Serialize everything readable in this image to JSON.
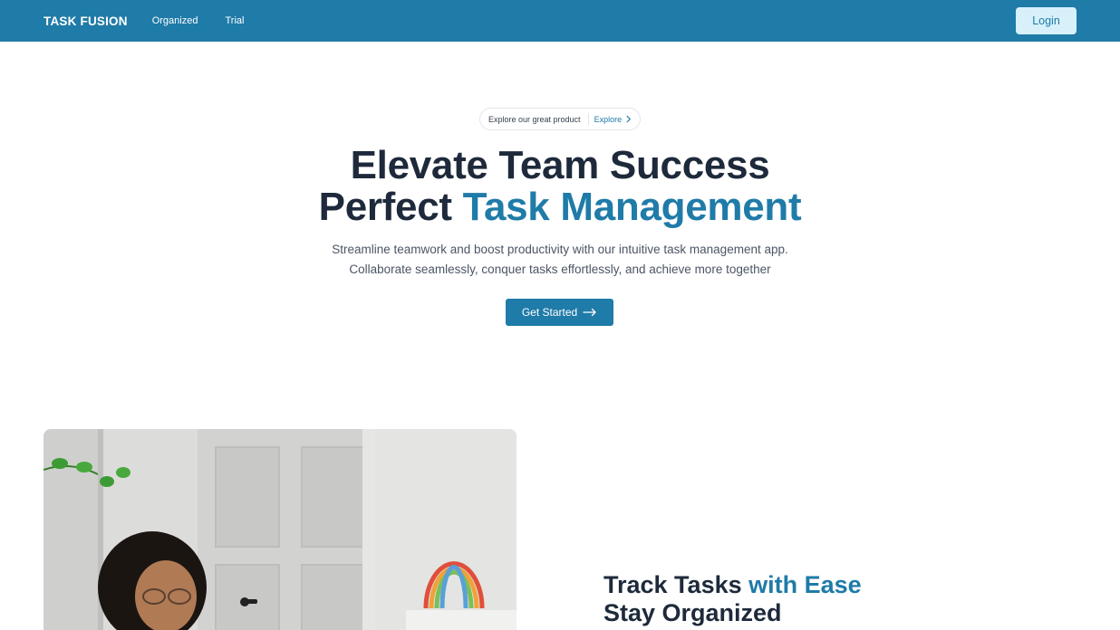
{
  "nav": {
    "brand": "TASK FUSION",
    "links": [
      "Organized",
      "Trial"
    ],
    "login_label": "Login"
  },
  "hero": {
    "pill_text": "Explore our great product",
    "pill_link": "Explore",
    "title_line1": "Elevate Team Success",
    "title_line2_plain": "Perfect ",
    "title_line2_accent": "Task Management",
    "subtitle_line1": "Streamline teamwork and boost productivity with our intuitive task management app.",
    "subtitle_line2": "Collaborate seamlessly, conquer tasks effortlessly, and achieve more together",
    "cta_label": "Get Started"
  },
  "feature": {
    "title_plain": "Track Tasks ",
    "title_accent": "with Ease",
    "title_line2": "Stay Organized"
  },
  "colors": {
    "brand": "#1f7ba8",
    "login_bg": "#d7f0fa",
    "heading": "#1e2a3b"
  },
  "icons": [
    "chevron-right-icon",
    "arrow-right-icon"
  ]
}
